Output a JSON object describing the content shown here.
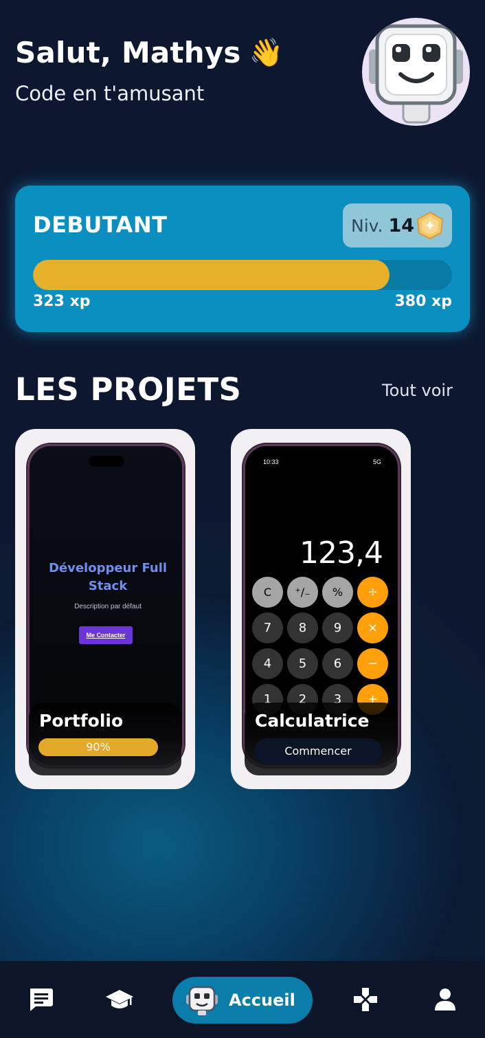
{
  "header": {
    "greeting": "Salut, Mathys",
    "wave_emoji": "👋",
    "subtitle": "Code en t'amusant"
  },
  "level": {
    "rank": "DEBUTANT",
    "niv_label": "Niv.",
    "niv_value": "14",
    "xp_current": "323 xp",
    "xp_target": "380 xp",
    "progress_fraction": 0.85,
    "bar_color": "#e7b22b"
  },
  "projects": {
    "section_title": "LES PROJETS",
    "see_all": "Tout voir",
    "items": [
      {
        "name": "Portfolio",
        "progress_label": "90%",
        "preview": {
          "title": "Développeur Full Stack",
          "description": "Description par défaut",
          "button": "Me Contacter"
        }
      },
      {
        "name": "Calculatrice",
        "action_label": "Commencer",
        "preview": {
          "time": "10:33",
          "signal": "5G",
          "display": "123,4",
          "keys": [
            "C",
            "⁺∕₋",
            "%",
            "÷",
            "7",
            "8",
            "9",
            "×",
            "4",
            "5",
            "6",
            "−",
            "1",
            "2",
            "3",
            "+"
          ]
        }
      }
    ]
  },
  "bottom_nav": {
    "items": [
      {
        "icon": "chat-icon"
      },
      {
        "icon": "graduation-cap-icon"
      },
      {
        "icon": "robot-icon",
        "label": "Accueil",
        "active": true
      },
      {
        "icon": "gamepad-icon"
      },
      {
        "icon": "user-icon"
      }
    ]
  },
  "colors": {
    "background": "#0d1830",
    "level_card": "#0a8fc0",
    "accent_orange": "#ff9f0a",
    "nav_active": "#0b7dab"
  }
}
